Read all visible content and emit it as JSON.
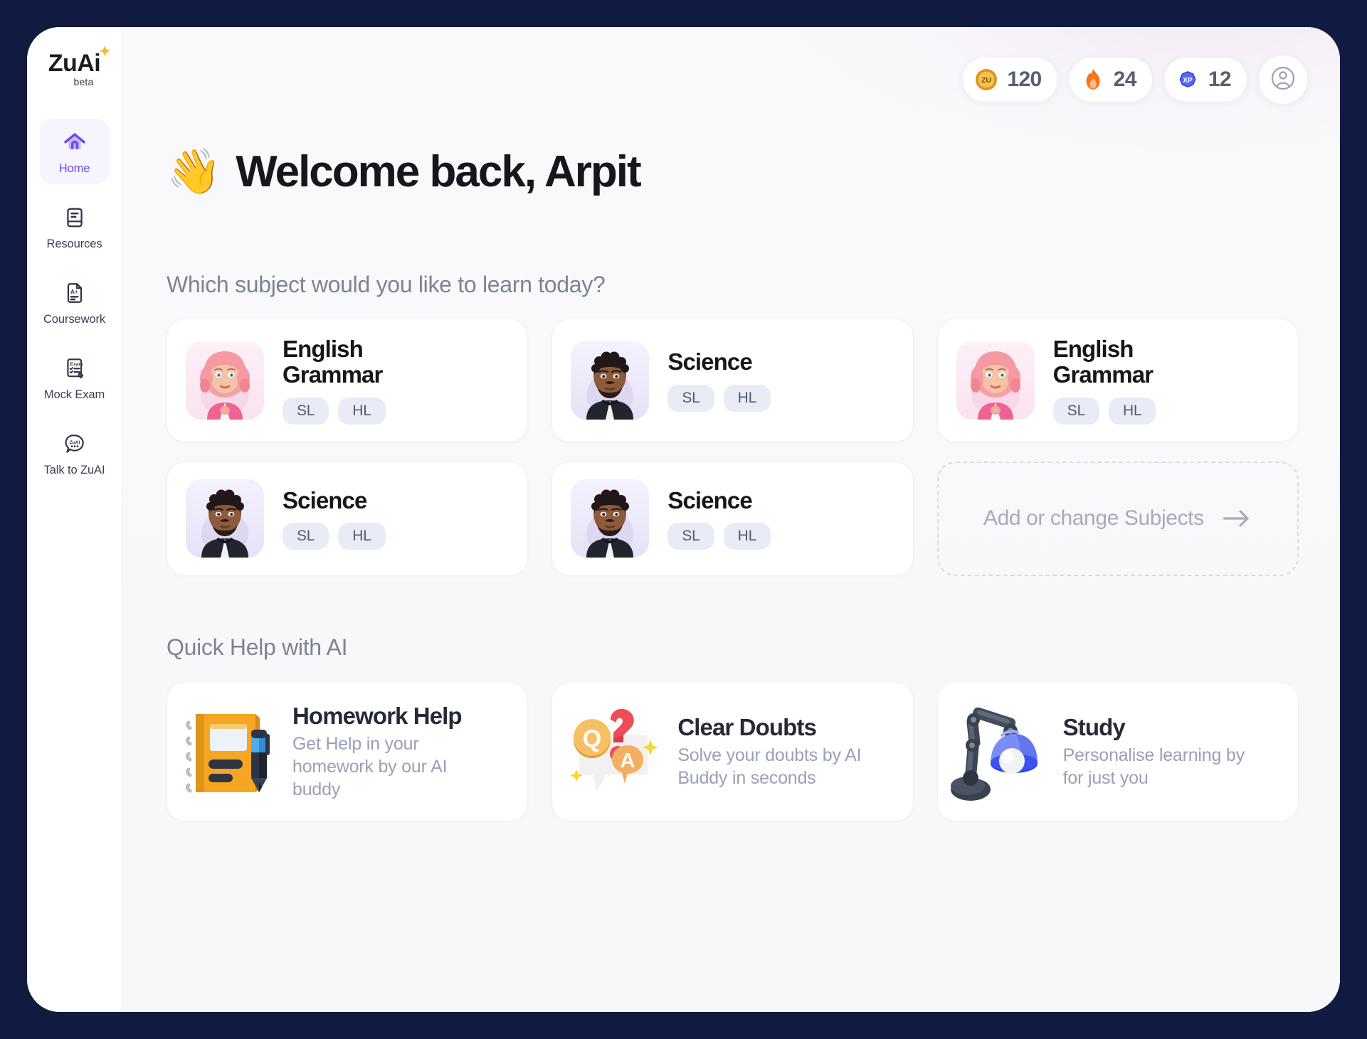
{
  "brand": {
    "logo_text": "ZuAi",
    "logo_badge": "beta",
    "accent_color": "#6d4aee",
    "frame_color": "#111a40"
  },
  "sidebar": {
    "items": [
      {
        "label": "Home",
        "icon": "home-icon",
        "active": true
      },
      {
        "label": "Resources",
        "icon": "book-icon",
        "active": false
      },
      {
        "label": "Coursework",
        "icon": "document-grade-icon",
        "active": false
      },
      {
        "label": "Mock Exam",
        "icon": "exam-paper-pencil-icon",
        "active": false
      },
      {
        "label": "Talk to ZuAI",
        "icon": "chat-bubble-zuai-icon",
        "active": false
      }
    ]
  },
  "topbar": {
    "stats": [
      {
        "id": "zu-coins",
        "icon": "zu-coin-icon",
        "icon_label": "ZU",
        "value": "120",
        "color": "#f5a623"
      },
      {
        "id": "streak",
        "icon": "flame-icon",
        "value": "24",
        "color": "#f97316"
      },
      {
        "id": "xp",
        "icon": "xp-badge-icon",
        "icon_label": "XP",
        "value": "12",
        "color": "#2f44e8"
      }
    ],
    "profile": {
      "icon": "user-avatar-icon"
    }
  },
  "header": {
    "emoji": "👋",
    "greeting": "Welcome back, Arpit"
  },
  "subjects_section": {
    "heading": "Which subject would you like to learn today?",
    "cards": [
      {
        "name": "English Grammar",
        "avatar": "female-pink-hair-avatar",
        "levels": [
          "SL",
          "HL"
        ]
      },
      {
        "name": "Science",
        "avatar": "male-beard-hoodie-avatar",
        "levels": [
          "SL",
          "HL"
        ]
      },
      {
        "name": "English Grammar",
        "avatar": "female-pink-hair-avatar",
        "levels": [
          "SL",
          "HL"
        ]
      },
      {
        "name": "Science",
        "avatar": "male-beard-hoodie-avatar",
        "levels": [
          "SL",
          "HL"
        ]
      },
      {
        "name": "Science",
        "avatar": "male-beard-hoodie-avatar",
        "levels": [
          "SL",
          "HL"
        ]
      }
    ],
    "add_card": {
      "label": "Add or change Subjects",
      "icon": "arrow-right-icon"
    }
  },
  "quick_help_section": {
    "heading": "Quick Help with AI",
    "cards": [
      {
        "title": "Homework Help",
        "description": "Get Help in your homework by our AI buddy",
        "art": "notebook-pen-art"
      },
      {
        "title": "Clear Doubts",
        "description": "Solve your doubts by AI Buddy in seconds",
        "art": "qa-speech-bubbles-art"
      },
      {
        "title": "Study",
        "description": "Personalise learning by for just you",
        "art": "desk-lamp-art"
      }
    ]
  }
}
